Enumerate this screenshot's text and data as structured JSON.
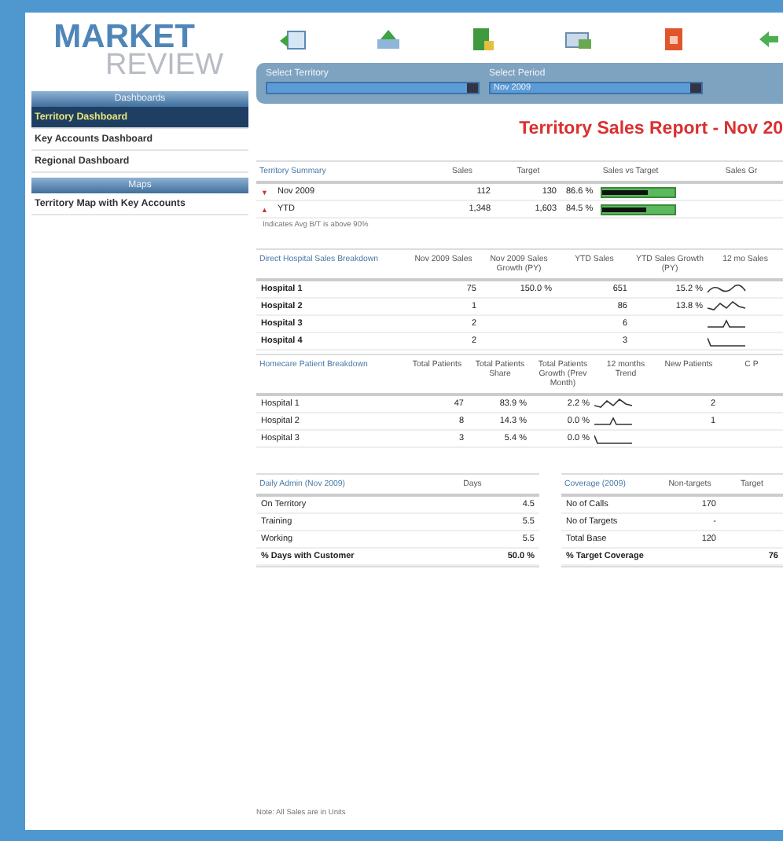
{
  "logo": {
    "line_1": "MARKET",
    "line_2": "REVIEW"
  },
  "sidebar": {
    "sections": [
      {
        "title": "Dashboards",
        "items": [
          {
            "label": "Territory Dashboard",
            "selected": true
          },
          {
            "label": "Key Accounts Dashboard",
            "selected": false
          },
          {
            "label": "Regional Dashboard",
            "selected": false
          }
        ]
      },
      {
        "title": "Maps",
        "items": [
          {
            "label": "Territory Map with Key Accounts",
            "selected": false
          }
        ]
      }
    ]
  },
  "toolbar": [
    {
      "kind": "back"
    },
    {
      "kind": "upload"
    },
    {
      "kind": "excel"
    },
    {
      "kind": "chart"
    },
    {
      "kind": "pdf"
    },
    {
      "kind": "arrow"
    }
  ],
  "filters": [
    {
      "label": "Select Territory"
    },
    {
      "label": "Select Period",
      "value": "Nov 2009"
    }
  ],
  "report_title": "Territory Sales Report - Nov 20",
  "summary": {
    "columns": [
      "Territory Summary",
      "Sales",
      "Target",
      "Sales vs Target",
      "Sales Gr"
    ],
    "rows": [
      {
        "marker": "▼",
        "cells": [
          "Nov 2009",
          "112",
          "130",
          "86.6 %"
        ],
        "level": 0.62
      },
      {
        "marker": "▲",
        "cells": [
          "YTD",
          "1,348",
          "1,603",
          "84.5 %"
        ],
        "level": 0.6
      }
    ],
    "note": "Indicates Avg B/T is above 90%"
  },
  "tables": [
    {
      "columns": [
        {
          "label": "Direct Hospital Sales Breakdown",
          "kind": "text"
        },
        {
          "label": "Nov 2009 Sales",
          "kind": "text"
        },
        {
          "label": "Nov 2009 Sales Growth (PY)",
          "kind": "text"
        },
        {
          "label": "YTD Sales",
          "kind": "text"
        },
        {
          "label": "YTD Sales Growth (PY)",
          "kind": "text"
        },
        {
          "label": "12 mo Sales",
          "kind": "trend"
        }
      ],
      "rows": [
        [
          "Hospital 1",
          "75",
          "150.0 %",
          "651",
          "15.2 %"
        ],
        [
          "Hospital 2",
          "1",
          "",
          "86",
          "13.8 %"
        ],
        [
          "Hospital 3",
          "2",
          "",
          "6",
          ""
        ],
        [
          "Hospital 4",
          "2",
          "",
          "3",
          ""
        ]
      ]
    },
    {
      "columns": [
        {
          "label": "Homecare Patient Breakdown",
          "kind": "text"
        },
        {
          "label": "Total Patients",
          "kind": "text"
        },
        {
          "label": "Total Patients Share",
          "kind": "text"
        },
        {
          "label": "Total Patients Growth (Prev Month)",
          "kind": "text"
        },
        {
          "label": "12 months Trend",
          "kind": "trend"
        },
        {
          "label": "New Patients",
          "kind": "text"
        },
        {
          "label": "C P",
          "kind": "text"
        }
      ],
      "rows": [
        [
          "Hospital 1",
          "47",
          "83.9 %",
          "2.2 %",
          "",
          "2"
        ],
        [
          "Hospital 2",
          "8",
          "14.3 %",
          "0.0 %",
          "",
          "1"
        ],
        [
          "Hospital 3",
          "3",
          "5.4 %",
          "0.0 %",
          "",
          ""
        ]
      ]
    }
  ],
  "small_tables": [
    {
      "columns": [
        "Daily Admin (Nov 2009)",
        "Days"
      ],
      "rows": [
        [
          "On Territory",
          "4.5"
        ],
        [
          "Training",
          "5.5"
        ],
        [
          "Working",
          "5.5"
        ],
        [
          "% Days with Customer",
          "50.0 %"
        ]
      ]
    },
    {
      "columns": [
        "Coverage (2009)",
        "Non-targets",
        "Target"
      ],
      "rows": [
        [
          "No of Calls",
          "170",
          ""
        ],
        [
          "No of Targets",
          "-",
          ""
        ],
        [
          "Total Base",
          "120",
          ""
        ],
        [
          "% Target Coverage",
          "",
          "76"
        ]
      ]
    }
  ],
  "footnote": "Note: All Sales are in Units"
}
